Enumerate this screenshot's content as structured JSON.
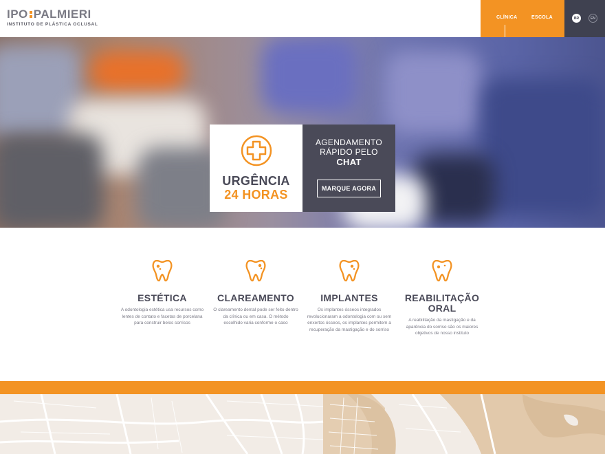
{
  "header": {
    "logo_left": "IPO",
    "logo_right": "PALMIERI",
    "logo_subtitle": "INSTITUTO DE PLÁSTICA OCLUSAL",
    "nav": [
      {
        "label": "CLÍNICA",
        "active": true
      },
      {
        "label": "ESCOLA",
        "active": false
      }
    ],
    "languages": [
      {
        "label": "BR",
        "active": true
      },
      {
        "label": "EN",
        "active": false
      }
    ]
  },
  "hero": {
    "urgency_line1": "URGÊNCIA",
    "urgency_line2": "24 HORAS",
    "chat_line1": "AGENDAMENTO",
    "chat_line2": "RÁPIDO PELO",
    "chat_line3": "CHAT",
    "cta_label": "MARQUE AGORA",
    "icon": "medical-cross-icon"
  },
  "services": [
    {
      "title": "ESTÉTICA",
      "description": "A odontologia estética usa recursos como lentes de contato e facetas de porcelana para construir belos sorrisos",
      "icon": "tooth-icon"
    },
    {
      "title": "CLAREAMENTO",
      "description": "O clareamento dental pode ser feito dentro da clínica ou em casa. O método escolhido varia conforme o caso",
      "icon": "tooth-icon"
    },
    {
      "title": "IMPLANTES",
      "description": "Os implantes ósseos integrados revolucionaram a odontologia com ou sem enxertos ósseos, os implantes permitem a recuperação da mastigação e do sorriso",
      "icon": "tooth-icon"
    },
    {
      "title": "REABILITAÇÃO ORAL",
      "description": "A reabilitação da mastigação e da aparência do sorriso são os maiores objetivos de nosso instituto",
      "icon": "tooth-icon"
    }
  ],
  "colors": {
    "accent": "#f39323",
    "dark": "#4a4a58",
    "nav_dark": "#3f4150",
    "map_bg": "#f2ece6"
  }
}
